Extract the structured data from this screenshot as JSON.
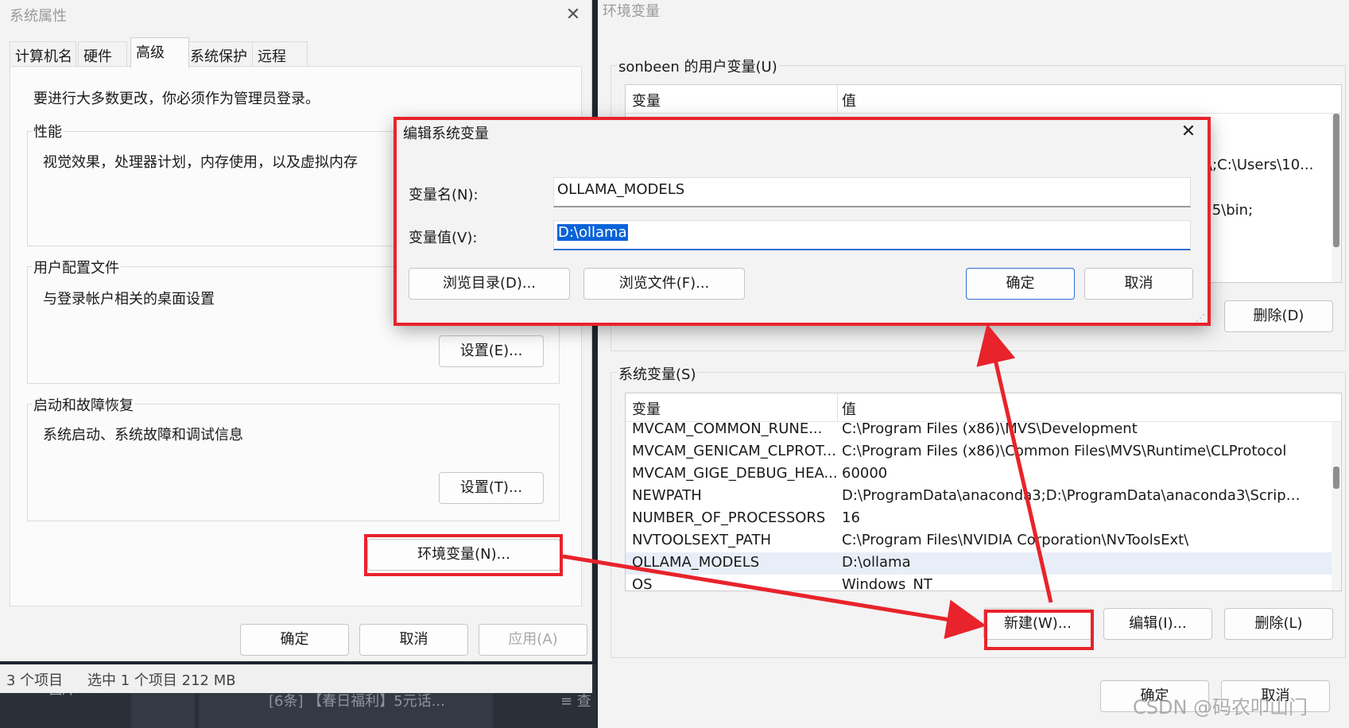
{
  "taskbar": {
    "left_text": "图片",
    "notice_text": "[6条] 【春日福利】5元话...",
    "right_text": "≡ 查"
  },
  "system_properties": {
    "title": "系统属性",
    "tabs": [
      "计算机名",
      "硬件",
      "高级",
      "系统保护",
      "远程"
    ],
    "active_tab": "高级",
    "admin_note": "要进行大多数更改，你必须作为管理员登录。",
    "performance": {
      "label": "性能",
      "description": "视觉效果，处理器计划，内存使用，以及虚拟内存"
    },
    "user_profiles": {
      "label": "用户配置文件",
      "description": "与登录帐户相关的桌面设置",
      "button": "设置(E)..."
    },
    "startup": {
      "label": "启动和故障恢复",
      "description": "系统启动、系统故障和调试信息",
      "button": "设置(T)..."
    },
    "env_button": "环境变量(N)...",
    "ok": "确定",
    "cancel": "取消",
    "apply": "应用(A)",
    "status": {
      "items": "3 个项目",
      "selected": "选中 1 个项目  212 MB"
    }
  },
  "environment_variables": {
    "title": "环境变量",
    "user_section_label": "sonbeen 的用户变量(U)",
    "user_header": {
      "var": "变量",
      "val": "值"
    },
    "user_value_fragments": [
      "\\;C:\\Users\\10...",
      ".5\\bin;"
    ],
    "user_delete": "删除(D)",
    "system_section_label": "系统变量(S)",
    "system_header": {
      "var": "变量",
      "val": "值"
    },
    "system_rows": [
      {
        "name": "MVCAM_COMMON_RUNE...",
        "value": "C:\\Program Files (x86)\\MVS\\Development"
      },
      {
        "name": "MVCAM_GENICAM_CLPROT...",
        "value": "C:\\Program Files (x86)\\Common Files\\MVS\\Runtime\\CLProtocol"
      },
      {
        "name": "MVCAM_GIGE_DEBUG_HEA...",
        "value": "60000"
      },
      {
        "name": "NEWPATH",
        "value": "D:\\ProgramData\\anaconda3;D:\\ProgramData\\anaconda3\\Scripts;..."
      },
      {
        "name": "NUMBER_OF_PROCESSORS",
        "value": "16"
      },
      {
        "name": "NVTOOLSEXT_PATH",
        "value": "C:\\Program Files\\NVIDIA Corporation\\NvToolsExt\\"
      },
      {
        "name": "OLLAMA_MODELS",
        "value": "D:\\ollama"
      },
      {
        "name": "OS",
        "value": "Windows_NT"
      }
    ],
    "new_button": "新建(W)...",
    "edit_button": "编辑(I)...",
    "delete_button": "删除(L)",
    "ok": "确定",
    "cancel": "取消"
  },
  "edit_dialog": {
    "title": "编辑系统变量",
    "name_label": "变量名(N):",
    "name_value": "OLLAMA_MODELS",
    "value_label": "变量值(V):",
    "value_value": "D:\\ollama",
    "browse_dir": "浏览目录(D)...",
    "browse_file": "浏览文件(F)...",
    "ok": "确定",
    "cancel": "取消"
  },
  "watermark": "CSDN @码农叩山门",
  "colors": {
    "annotation_red": "#e8232b",
    "accent_blue": "#2f6fd6",
    "selection_blue": "#0b63d8"
  }
}
